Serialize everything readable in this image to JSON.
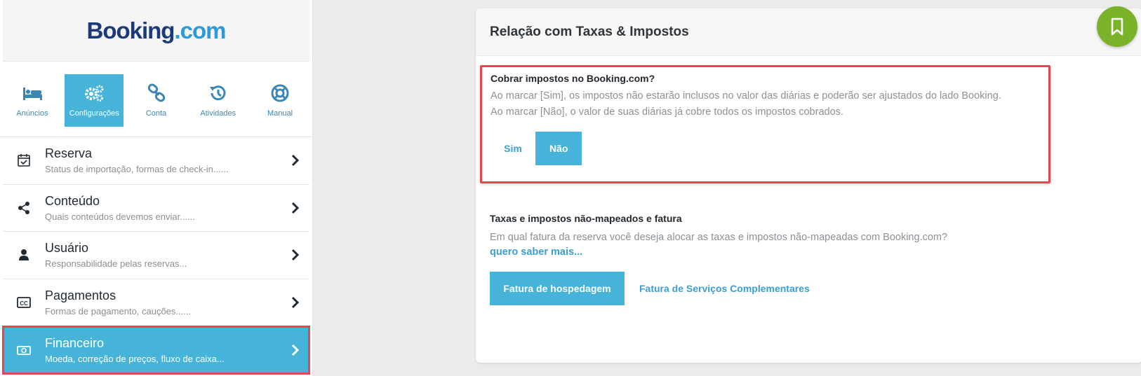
{
  "brand": {
    "logo_main": "Booking",
    "logo_suffix": ".com"
  },
  "nav_tabs": [
    {
      "label": "Anúncios",
      "icon": "bed-icon"
    },
    {
      "label": "Configurações",
      "icon": "gears-icon",
      "active": true
    },
    {
      "label": "Conta",
      "icon": "link-icon"
    },
    {
      "label": "Atividades",
      "icon": "history-icon"
    },
    {
      "label": "Manual",
      "icon": "lifebuoy-icon"
    }
  ],
  "menu": [
    {
      "title": "Reserva",
      "subtitle": "Status de importação, formas de check-in......",
      "icon": "calendar-check-icon"
    },
    {
      "title": "Conteúdo",
      "subtitle": "Quais conteúdos devemos enviar......",
      "icon": "share-icon"
    },
    {
      "title": "Usuário",
      "subtitle": "Responsabilidade pelas reservas...",
      "icon": "user-icon"
    },
    {
      "title": "Pagamentos",
      "subtitle": "Formas de pagamento, cauções......",
      "icon": "credit-card-icon"
    },
    {
      "title": "Financeiro",
      "subtitle": "Moeda, correção de preços, fluxo de caixa...",
      "icon": "money-icon",
      "active": true
    }
  ],
  "panel": {
    "title": "Relação com Taxas & Impostos",
    "collect_taxes": {
      "title": "Cobrar impostos no Booking.com?",
      "desc_line1": "Ao marcar [Sim], os impostos não estarão inclusos no valor das diárias e poderão ser ajustados do lado Booking.",
      "desc_line2": "Ao marcar [Não], o valor de suas diárias já cobre todos os impostos cobrados.",
      "option_yes": "Sim",
      "option_no": "Não",
      "selected": "Não"
    },
    "unmapped": {
      "title": "Taxas e impostos não-mapeados e fatura",
      "desc": "Em qual fatura da reserva você deseja alocar as taxas e impostos não-mapeadas com Booking.com?",
      "link": "quero saber mais...",
      "option_lodging": "Fatura de hospedagem",
      "option_services": "Fatura de Serviços Complementares",
      "selected": "Fatura de hospedagem"
    }
  },
  "colors": {
    "accent": "#46b3d9",
    "highlight_border": "#e3474f",
    "fab": "#7cb22a",
    "logo_dark": "#1b3a7a",
    "logo_light": "#2e9ad9"
  }
}
